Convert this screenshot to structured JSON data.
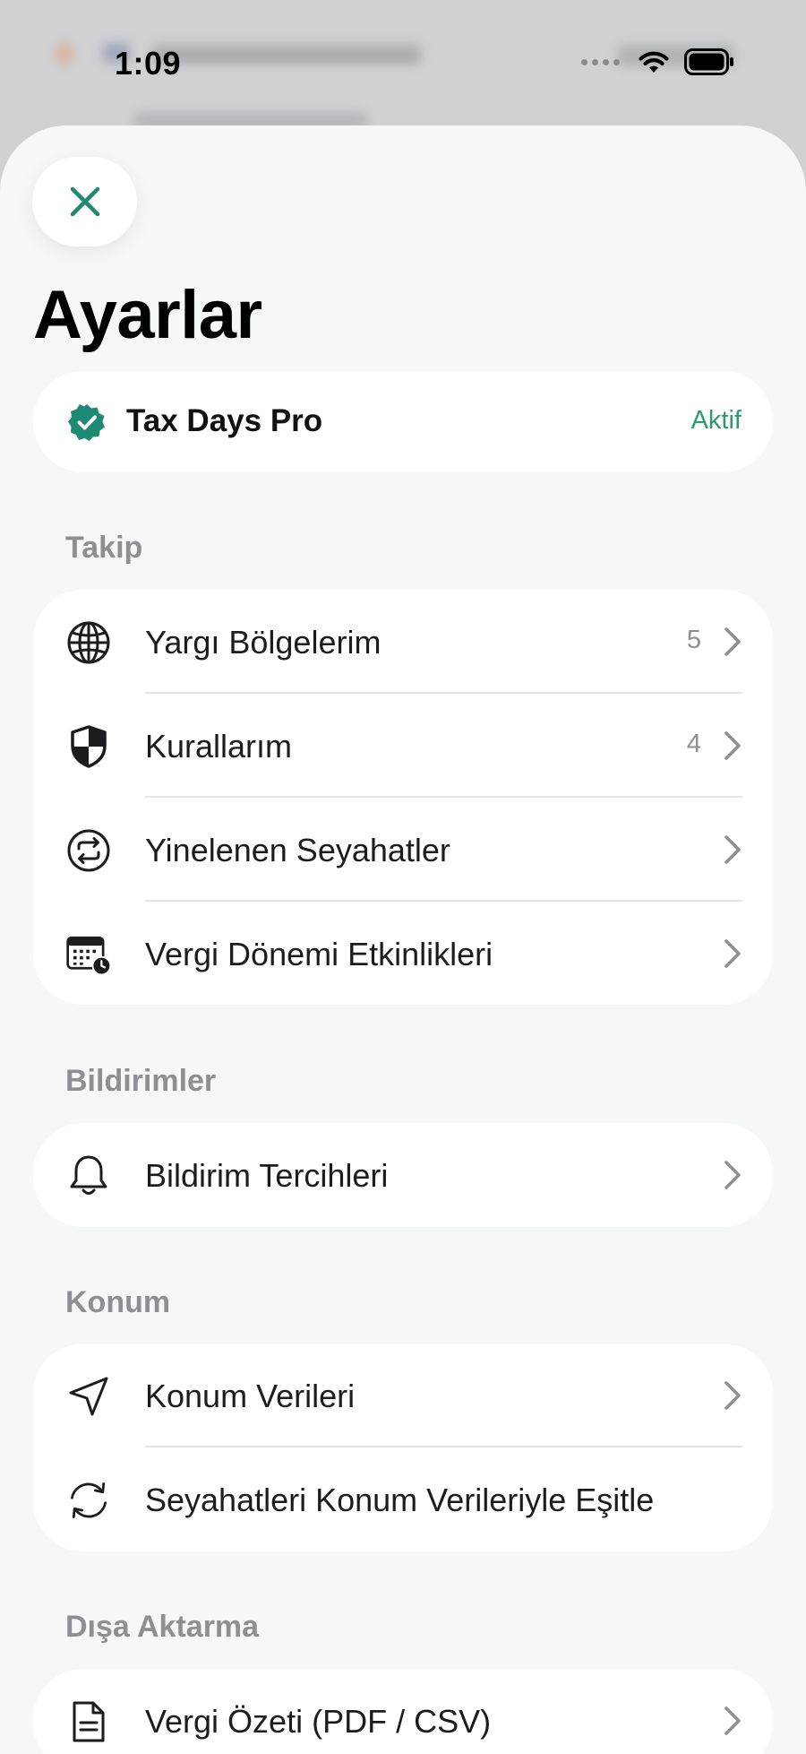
{
  "status_bar": {
    "time": "1:09"
  },
  "header": {
    "title": "Ayarlar",
    "close_icon": "close-icon"
  },
  "pro": {
    "name": "Tax Days Pro",
    "status": "Aktif",
    "accent_color": "#2f9a6f",
    "icon": "verified-badge-icon"
  },
  "sections": {
    "tracking": {
      "label": "Takip",
      "items": [
        {
          "label": "Yargı Bölgelerim",
          "count": "5",
          "icon": "globe-icon"
        },
        {
          "label": "Kurallarım",
          "count": "4",
          "icon": "shield-icon"
        },
        {
          "label": "Yinelenen Seyahatler",
          "icon": "repeat-icon"
        },
        {
          "label": "Vergi Dönemi Etkinlikleri",
          "icon": "calendar-clock-icon"
        }
      ]
    },
    "notifications": {
      "label": "Bildirimler",
      "items": [
        {
          "label": "Bildirim Tercihleri",
          "icon": "bell-icon"
        }
      ]
    },
    "location": {
      "label": "Konum",
      "items": [
        {
          "label": "Konum Verileri",
          "icon": "location-arrow-icon"
        },
        {
          "label": "Seyahatleri Konum Verileriyle Eşitle",
          "icon": "sync-icon"
        }
      ]
    },
    "export": {
      "label": "Dışa Aktarma",
      "items": [
        {
          "label": "Vergi Özeti (PDF / CSV)",
          "icon": "document-icon"
        }
      ]
    }
  }
}
